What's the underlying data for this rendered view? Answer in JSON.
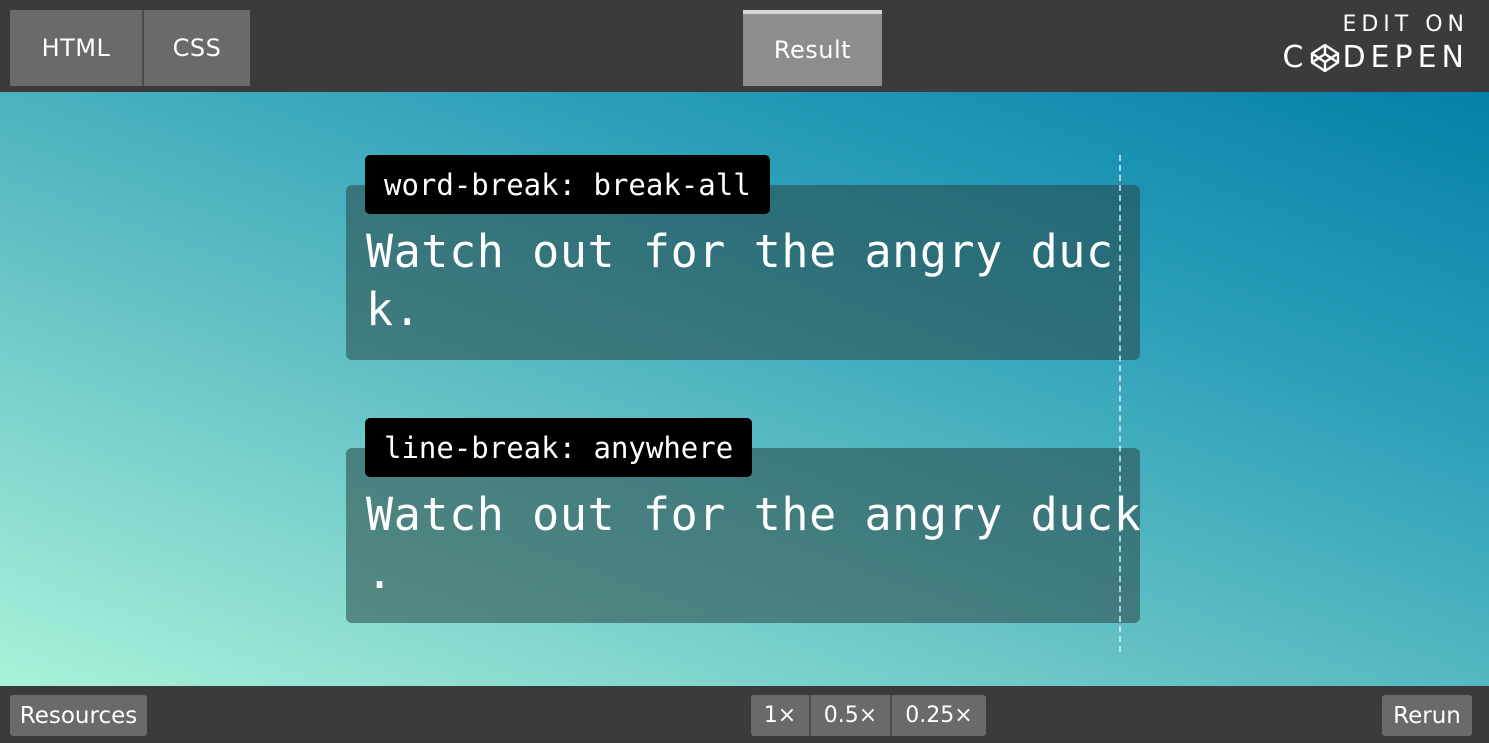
{
  "tabs": {
    "html": "HTML",
    "css": "CSS",
    "result": "Result"
  },
  "codepen": {
    "edit_on": "EDIT ON",
    "brand_left": "C",
    "brand_right": "DEPEN",
    "icon": "codepen-logo-icon"
  },
  "examples": [
    {
      "badge": "word-break: break-all",
      "line1": "Watch out for the angry duc",
      "line2": "k."
    },
    {
      "badge": "line-break: anywhere",
      "line1": "Watch out for the angry duck",
      "line2": "."
    }
  ],
  "bottom": {
    "resources": "Resources",
    "zoom": [
      "1×",
      "0.5×",
      "0.25×"
    ],
    "rerun": "Rerun"
  },
  "colors": {
    "chrome": "#3b3b3e",
    "tab": "#6a6a6c",
    "active_tab": "#8d8d8f",
    "gradient_start": "#a9f2da",
    "gradient_end": "#067fa8",
    "badge_bg": "#000000"
  }
}
